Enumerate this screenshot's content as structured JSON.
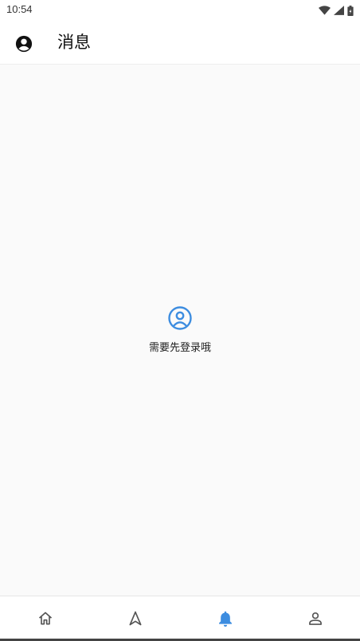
{
  "status_bar": {
    "time": "10:54",
    "icons": [
      "wifi-icon",
      "signal-icon",
      "battery-icon"
    ]
  },
  "app_bar": {
    "title": "消息",
    "avatar_icon": "account-circle-icon"
  },
  "empty_state": {
    "icon": "user-circle-outline-icon",
    "message": "需要先登录哦"
  },
  "bottom_nav": {
    "items": [
      {
        "icon": "home-icon",
        "active": false
      },
      {
        "icon": "navigation-icon",
        "active": false
      },
      {
        "icon": "bell-icon",
        "active": true
      },
      {
        "icon": "person-icon",
        "active": false
      }
    ]
  },
  "colors": {
    "accent": "#3d8de0",
    "inactive_icon": "#555555",
    "background": "#fafafa"
  }
}
